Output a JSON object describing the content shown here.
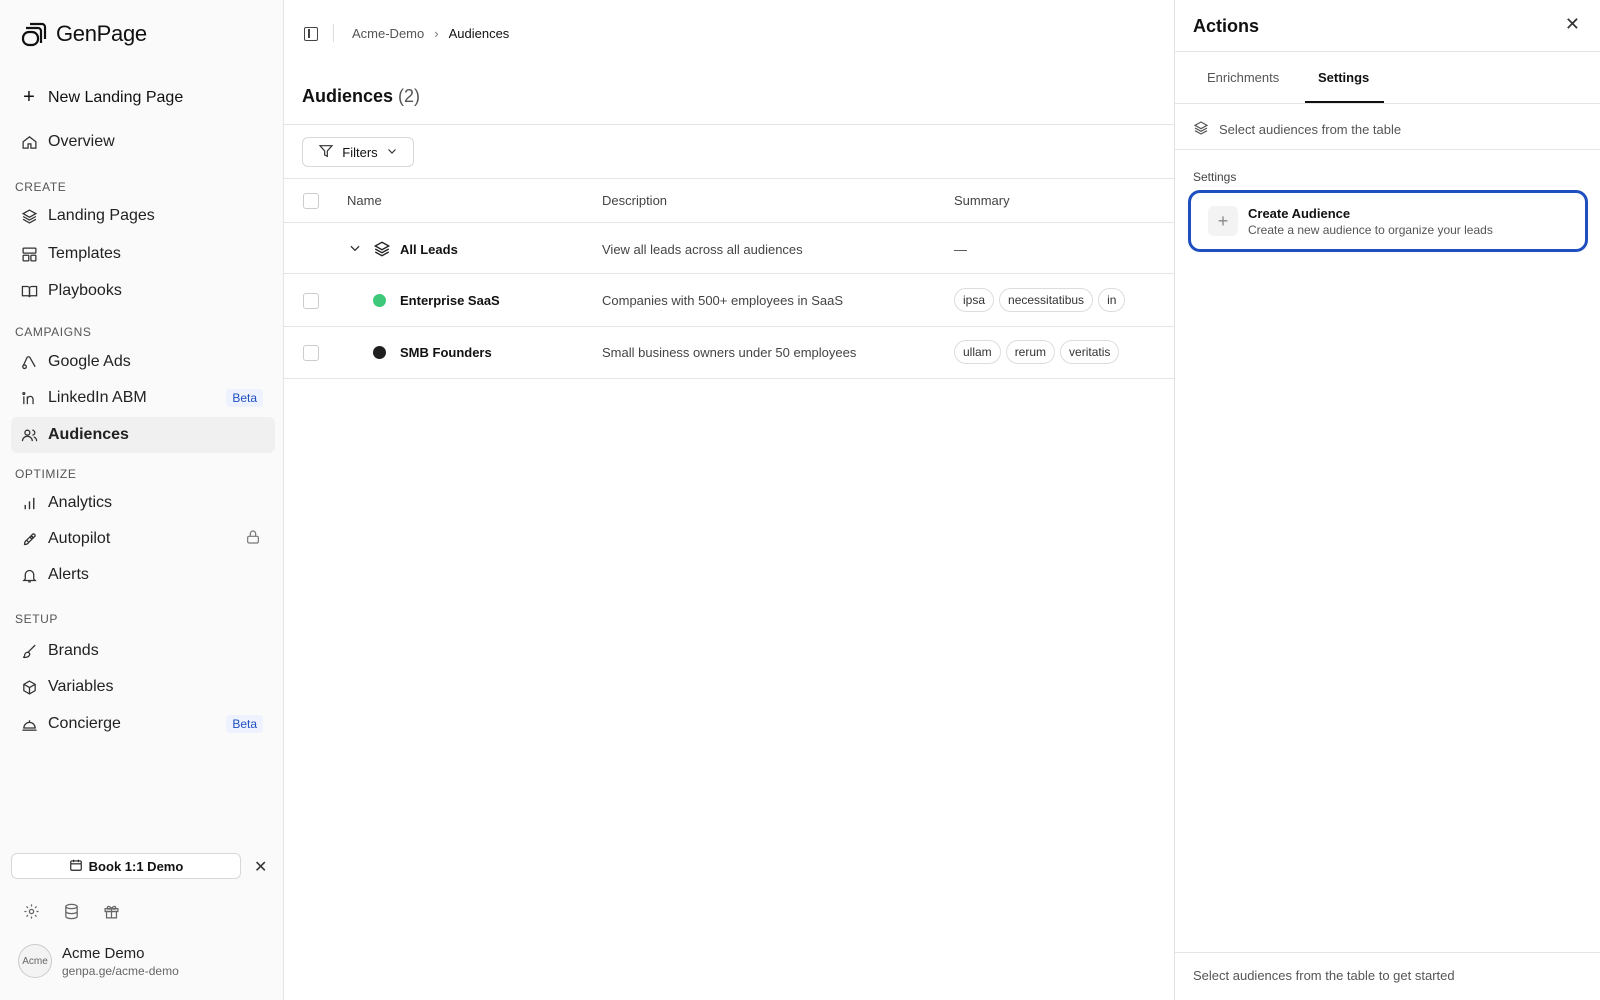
{
  "brand": {
    "name": "GenPage"
  },
  "sidebar": {
    "new_page": "New Landing Page",
    "overview": "Overview",
    "sections": {
      "create": "CREATE",
      "campaigns": "CAMPAIGNS",
      "optimize": "OPTIMIZE",
      "setup": "SETUP"
    },
    "items": {
      "landing_pages": "Landing Pages",
      "templates": "Templates",
      "playbooks": "Playbooks",
      "google_ads": "Google Ads",
      "linkedin_abm": "LinkedIn ABM",
      "audiences": "Audiences",
      "analytics": "Analytics",
      "autopilot": "Autopilot",
      "alerts": "Alerts",
      "brands": "Brands",
      "variables": "Variables",
      "concierge": "Concierge"
    },
    "beta_badge": "Beta",
    "demo_button": "Book 1:1 Demo",
    "user": {
      "name": "Acme Demo",
      "url": "genpa.ge/acme-demo",
      "avatar_alt": "Acme"
    }
  },
  "breadcrumb": {
    "workspace": "Acme-Demo",
    "current": "Audiences"
  },
  "page": {
    "title": "Audiences",
    "count": "(2)"
  },
  "filters": {
    "label": "Filters"
  },
  "table": {
    "columns": {
      "name": "Name",
      "description": "Description",
      "summary": "Summary"
    },
    "group": {
      "name": "All Leads",
      "description": "View all leads across all audiences",
      "summary": "—"
    },
    "rows": [
      {
        "name": "Enterprise SaaS",
        "description": "Companies with 500+ employees in SaaS",
        "color": "#3ec97a",
        "tags": [
          "ipsa",
          "necessitatibus",
          "in"
        ]
      },
      {
        "name": "SMB Founders",
        "description": "Small business owners under 50 employees",
        "color": "#1f1f1f",
        "tags": [
          "ullam",
          "rerum",
          "veritatis"
        ]
      }
    ]
  },
  "panel": {
    "title": "Actions",
    "tabs": {
      "enrichments": "Enrichments",
      "settings": "Settings"
    },
    "select_hint": "Select audiences from the table",
    "settings_label": "Settings",
    "create": {
      "title": "Create Audience",
      "subtitle": "Create a new audience to organize your leads"
    },
    "footer": "Select audiences from the table to get started"
  },
  "colors": {
    "accent": "#1f4fbf"
  }
}
